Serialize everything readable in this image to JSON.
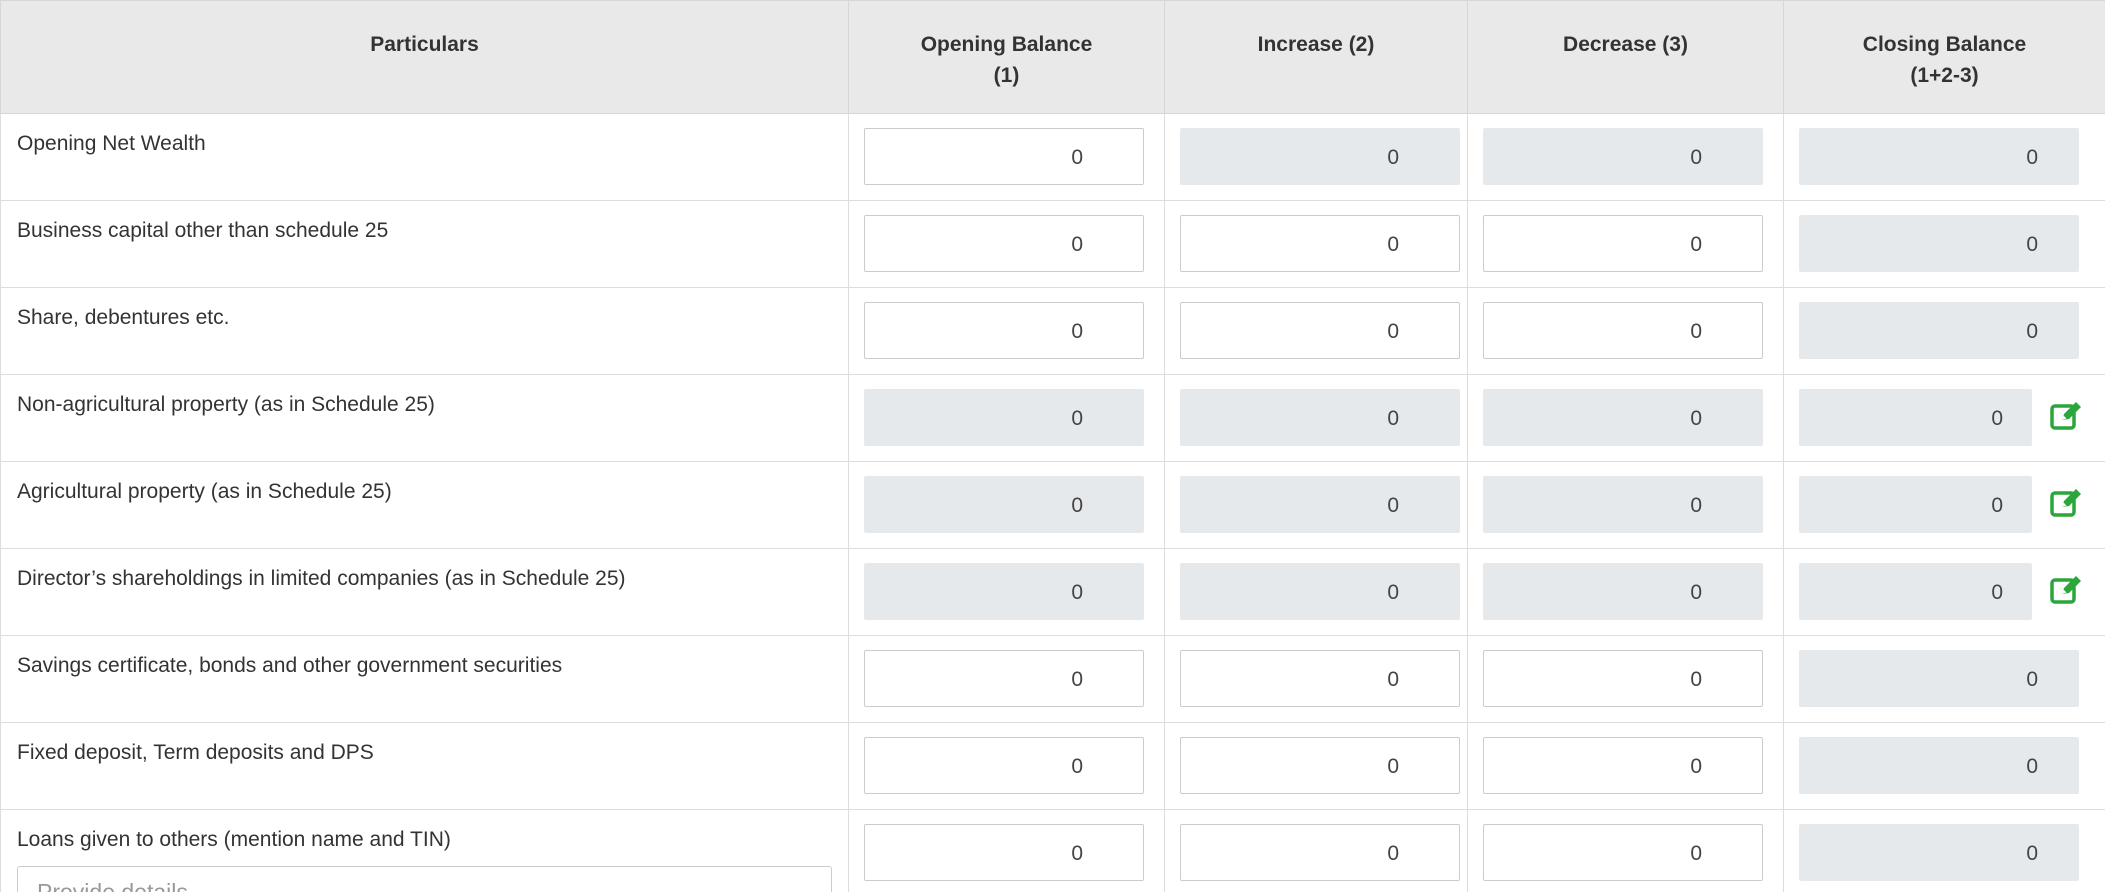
{
  "table": {
    "headers": {
      "particulars": "Particulars",
      "opening_line1": "Opening Balance",
      "opening_line2": "(1)",
      "increase": "Increase (2)",
      "decrease": "Decrease (3)",
      "closing_line1": "Closing Balance",
      "closing_line2": "(1+2-3)"
    },
    "rows": [
      {
        "label": "Opening Net Wealth",
        "opening": "0",
        "increase": "0",
        "decrease": "0",
        "closing": "0",
        "readonly": {
          "opening": false,
          "increase": true,
          "decrease": true,
          "closing": true
        },
        "edit_icon": false
      },
      {
        "label": "Business capital other than schedule 25",
        "opening": "0",
        "increase": "0",
        "decrease": "0",
        "closing": "0",
        "readonly": {
          "opening": false,
          "increase": false,
          "decrease": false,
          "closing": true
        },
        "edit_icon": false
      },
      {
        "label": "Share, debentures etc.",
        "opening": "0",
        "increase": "0",
        "decrease": "0",
        "closing": "0",
        "readonly": {
          "opening": false,
          "increase": false,
          "decrease": false,
          "closing": true
        },
        "edit_icon": false
      },
      {
        "label": "Non-agricultural property (as in Schedule 25)",
        "opening": "0",
        "increase": "0",
        "decrease": "0",
        "closing": "0",
        "readonly": {
          "opening": true,
          "increase": true,
          "decrease": true,
          "closing": true
        },
        "edit_icon": true
      },
      {
        "label": "Agricultural property (as in Schedule 25)",
        "opening": "0",
        "increase": "0",
        "decrease": "0",
        "closing": "0",
        "readonly": {
          "opening": true,
          "increase": true,
          "decrease": true,
          "closing": true
        },
        "edit_icon": true
      },
      {
        "label": "Director’s shareholdings in limited companies (as in Schedule 25)",
        "opening": "0",
        "increase": "0",
        "decrease": "0",
        "closing": "0",
        "readonly": {
          "opening": true,
          "increase": true,
          "decrease": true,
          "closing": true
        },
        "edit_icon": true
      },
      {
        "label": "Savings certificate, bonds and other government securities",
        "opening": "0",
        "increase": "0",
        "decrease": "0",
        "closing": "0",
        "readonly": {
          "opening": false,
          "increase": false,
          "decrease": false,
          "closing": true
        },
        "edit_icon": false
      },
      {
        "label": "Fixed deposit, Term deposits and DPS",
        "opening": "0",
        "increase": "0",
        "decrease": "0",
        "closing": "0",
        "readonly": {
          "opening": false,
          "increase": false,
          "decrease": false,
          "closing": true
        },
        "edit_icon": false
      },
      {
        "label": "Loans given to others (mention name and TIN)",
        "opening": "0",
        "increase": "0",
        "decrease": "0",
        "closing": "0",
        "readonly": {
          "opening": false,
          "increase": false,
          "decrease": false,
          "closing": true
        },
        "edit_icon": false,
        "details_placeholder": "Provide details"
      }
    ]
  },
  "icons": {
    "edit": "edit-pencil-square-icon"
  },
  "colors": {
    "header_bg": "#e9e9e9",
    "readonly_bg": "#e6e9ec",
    "edit_icon": "#2aa63a",
    "border": "#dddddd"
  }
}
